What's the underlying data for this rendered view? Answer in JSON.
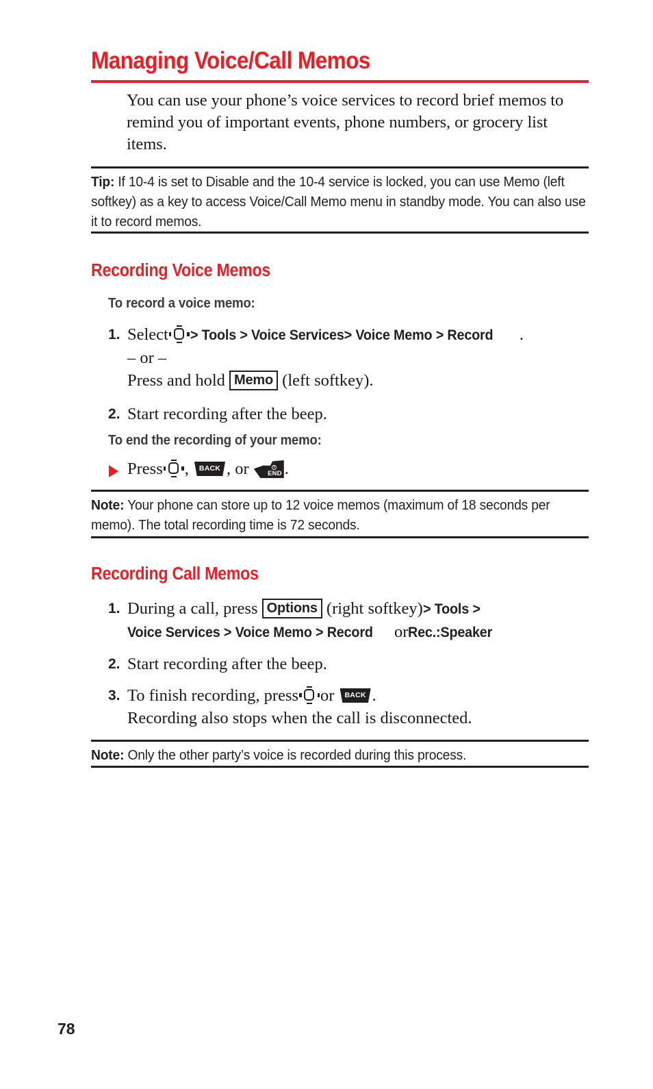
{
  "document": {
    "title": "Managing Voice/Call Memos",
    "page_number": "78",
    "accent_color": "#ec1d24",
    "text_color": "#231f20"
  },
  "intro": {
    "paragraph": "You can use your phone’s voice services to record brief memos to remind you of important events, phone numbers, or grocery list items."
  },
  "tip": {
    "lead": "Tip:",
    "text": " If 10-4 is set to Disable and the 10-4 service is locked, you can use Memo (left softkey) as a key to access Voice/Call Memo menu in standby mode. You can also use it to record memos."
  },
  "recording_voice_memos": {
    "heading": "Recording Voice Memos",
    "sub_heading_1": "To record a voice memo:",
    "step1": {
      "number": "1.",
      "lead": "Select",
      "nav_icon": "navigation-key-icon",
      "menu_path": "> Tools > Voice Services> Voice Memo > Record",
      "period": ".",
      "or_line": "– or –",
      "alt_lead": "Press and hold",
      "softkey_label": "Memo",
      "alt_tail": "(left softkey)."
    },
    "step2": {
      "number": "2.",
      "text": "Start recording after the beep."
    },
    "sub_heading_2": "To end the recording of your memo:",
    "bullet_step": {
      "bullet": "triangle-bullet-icon",
      "lead": "Press",
      "nav_icon": "navigation-key-icon",
      "comma_1": ",",
      "back_key": "BACK",
      "comma_2": ", or",
      "end_key": "END",
      "period": "."
    }
  },
  "note_1": {
    "lead": "Note:",
    "text": " Your phone can store up to 12 voice memos (maximum of 18 seconds per memo). The total recording time is 72 seconds."
  },
  "recording_call_memos": {
    "heading": "Recording Call Memos",
    "step1": {
      "number": "1.",
      "lead": "During a call, press",
      "softkey_label": "Options",
      "mid": "(right softkey)",
      "menu_path_1": "> Tools >",
      "menu_path_2": "Voice Services > Voice Memo > Record",
      "or_word": "or",
      "menu_path_3": "Rec.:Speaker"
    },
    "step2": {
      "number": "2.",
      "text": "Start recording after the beep."
    },
    "step3": {
      "number": "3.",
      "lead": "To finish recording, press",
      "nav_icon": "navigation-key-icon",
      "mid": "or",
      "back_key": "BACK",
      "period": ".",
      "tail": "Recording also stops when the call is disconnected."
    }
  },
  "note_2": {
    "lead": "Note:",
    "text": " Only the other party’s voice is recorded during this process."
  }
}
